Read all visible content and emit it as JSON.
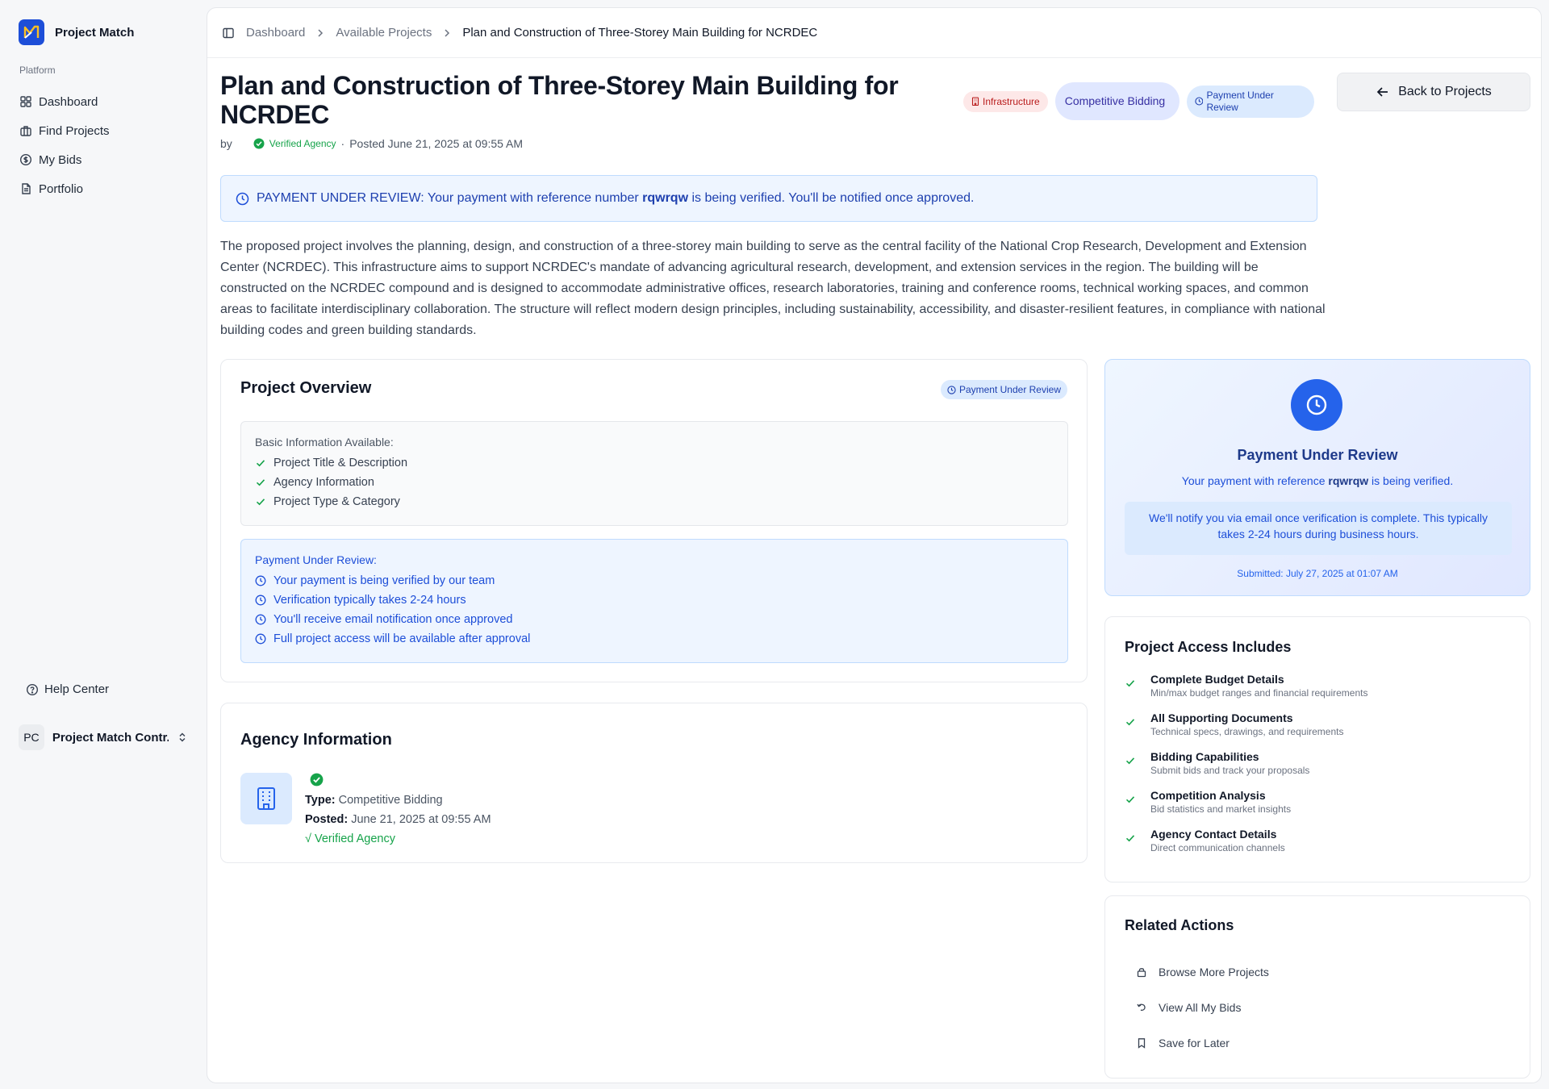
{
  "app": {
    "name": "Project Match"
  },
  "sidebar": {
    "section_label": "Platform",
    "items": [
      {
        "label": "Dashboard",
        "icon": "grid-icon"
      },
      {
        "label": "Find Projects",
        "icon": "briefcase-icon"
      },
      {
        "label": "My Bids",
        "icon": "dollar-circle-icon"
      },
      {
        "label": "Portfolio",
        "icon": "document-icon"
      }
    ],
    "help_label": "Help Center",
    "user": {
      "initials": "PC",
      "name": "Project Match Contr..."
    }
  },
  "breadcrumb": {
    "items": [
      "Dashboard",
      "Available Projects",
      "Plan and Construction of Three-Storey Main Building for NCRDEC"
    ]
  },
  "project": {
    "title": "Plan and Construction of Three-Storey Main Building for NCRDEC",
    "by_label": "by",
    "verified_label": "Verified Agency",
    "posted": "Posted June 21, 2025 at 09:55 AM",
    "tags": {
      "category": "Infrastructure",
      "type": "Competitive Bidding",
      "status": "Payment Under Review"
    },
    "back_label": "Back to Projects",
    "banner": {
      "prefix": "PAYMENT UNDER REVIEW: Your payment with reference number",
      "reference": "rqwrqw",
      "suffix": "is being verified. You'll be notified once approved."
    },
    "description": "The proposed project involves the planning, design, and construction of a three-storey main building to serve as the central facility of the National Crop Research, Development and Extension Center (NCRDEC). This infrastructure aims to support NCRDEC's mandate of advancing agricultural research, development, and extension services in the region. The building will be constructed on the NCRDEC compound and is designed to accommodate administrative offices, research laboratories, training and conference rooms, technical working spaces, and common areas to facilitate interdisciplinary collaboration. The structure will reflect modern design principles, including sustainability, accessibility, and disaster-resilient features, in compliance with national building codes and green building standards."
  },
  "overview": {
    "title": "Project Overview",
    "badge": "Payment Under Review",
    "basic_heading": "Basic Information Available:",
    "basic_items": [
      "Project Title & Description",
      "Agency Information",
      "Project Type & Category"
    ],
    "payment_heading": "Payment Under Review:",
    "payment_items": [
      "Your payment is being verified by our team",
      "Verification typically takes 2-24 hours",
      "You'll receive email notification once approved",
      "Full project access will be available after approval"
    ]
  },
  "agency": {
    "title": "Agency Information",
    "type_label": "Type:",
    "type_value": "Competitive Bidding",
    "posted_label": "Posted:",
    "posted_value": "June 21, 2025 at 09:55 AM",
    "verified": "√ Verified Agency"
  },
  "review_card": {
    "title": "Payment Under Review",
    "sub_prefix": "Your payment with reference",
    "reference": "rqwrqw",
    "sub_suffix": "is being verified.",
    "note": "We'll notify you via email once verification is complete. This typically takes 2-24 hours during business hours.",
    "submitted": "Submitted: July 27, 2025 at 01:07 AM"
  },
  "access": {
    "title": "Project Access Includes",
    "items": [
      {
        "title": "Complete Budget Details",
        "desc": "Min/max budget ranges and financial requirements"
      },
      {
        "title": "All Supporting Documents",
        "desc": "Technical specs, drawings, and requirements"
      },
      {
        "title": "Bidding Capabilities",
        "desc": "Submit bids and track your proposals"
      },
      {
        "title": "Competition Analysis",
        "desc": "Bid statistics and market insights"
      },
      {
        "title": "Agency Contact Details",
        "desc": "Direct communication channels"
      }
    ]
  },
  "related": {
    "title": "Related Actions",
    "items": [
      {
        "label": "Browse More Projects",
        "icon": "lock-icon"
      },
      {
        "label": "View All My Bids",
        "icon": "undo-icon"
      },
      {
        "label": "Save for Later",
        "icon": "bookmark-icon"
      }
    ]
  },
  "colors": {
    "accent": "#2563eb",
    "success": "#16a34a",
    "danger": "#b91c1c"
  }
}
